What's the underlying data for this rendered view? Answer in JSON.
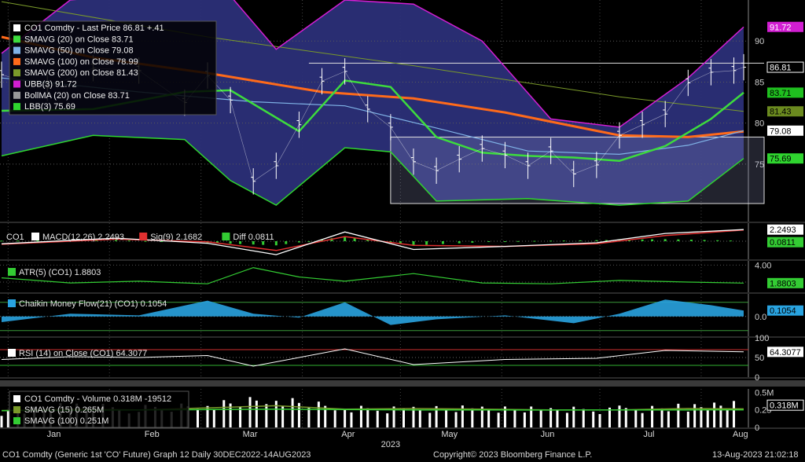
{
  "chart_data": {
    "type": "line",
    "x_range": [
      "2022-12-30",
      "2023-08-14"
    ],
    "x_ticks": [
      "Jan",
      "Feb",
      "Mar",
      "Apr",
      "May",
      "Jun",
      "Jul",
      "Aug"
    ],
    "year_label": "2023",
    "footer": {
      "left": "CO1 Comdty (Generic 1st 'CO' Future) Graph 12  Daily 30DEC2022-14AUG2023",
      "center": "Copyright© 2023 Bloomberg Finance L.P.",
      "right": "13-Aug-2023 21:02:18"
    },
    "colors": {
      "price": "#ffffff",
      "sma20": "#3ddc3d",
      "sma50": "#7fb2e6",
      "sma100": "#ff6a1a",
      "sma200": "#7a9a2a",
      "ubb": "#d21ed2",
      "lbb": "#2fd52f",
      "band_fill": "#2b2f78",
      "macd": "#ffffff",
      "signal": "#e03030",
      "diff": "#33cc33",
      "atr": "#33cc33",
      "cmf": "#29a3e0",
      "rsi": "#ffffff",
      "volume": "#ffffff"
    },
    "panels": [
      {
        "id": "price",
        "y_ticks": [
          75,
          80,
          85,
          90
        ],
        "ylim": [
          68,
          95
        ],
        "legend": [
          {
            "swatch": "#ffffff",
            "text": "CO1 Comdty - Last Price 86.81  +.41"
          },
          {
            "swatch": "#3ddc3d",
            "text": "SMAVG (20)  on Close      83.71"
          },
          {
            "swatch": "#7fb2e6",
            "text": "SMAVG (50)  on Close      79.08"
          },
          {
            "swatch": "#ff6a1a",
            "text": "SMAVG (100)  on Close     78.99"
          },
          {
            "swatch": "#7a9a2a",
            "text": "SMAVG (200)  on Close     81.43"
          },
          {
            "swatch": "#d21ed2",
            "text": "UBB(3)                     91.72"
          },
          {
            "swatch": "#9a9a9a",
            "text": "BollMA (20)  on Close     83.71"
          },
          {
            "swatch": "#2fd52f",
            "text": "LBB(3)                     75.69"
          }
        ],
        "badges": [
          {
            "text": "91.72",
            "value": 91.72,
            "bg": "#d21ed2",
            "fg": "#ffffff"
          },
          {
            "text": "86.81",
            "value": 86.81,
            "bg": "#000000",
            "fg": "#ffffff",
            "border": "#ffffff"
          },
          {
            "text": "83.71",
            "value": 83.71,
            "bg": "#1fbf1f",
            "fg": "#000000"
          },
          {
            "text": "81.43",
            "value": 81.43,
            "bg": "#6b8a1f",
            "fg": "#000000"
          },
          {
            "text": "79.08",
            "value": 79.08,
            "bg": "#ffffff",
            "fg": "#000000"
          },
          {
            "text": "75.69",
            "value": 75.69,
            "bg": "#2fd52f",
            "fg": "#000000"
          }
        ],
        "price_x": [
          "2022-12-30",
          "2023-01-13",
          "2023-01-27",
          "2023-02-10",
          "2023-02-24",
          "2023-03-03",
          "2023-03-10",
          "2023-03-17",
          "2023-03-24",
          "2023-03-31",
          "2023-04-07",
          "2023-04-14",
          "2023-04-21",
          "2023-04-28",
          "2023-05-05",
          "2023-05-12",
          "2023-05-19",
          "2023-05-26",
          "2023-06-02",
          "2023-06-09",
          "2023-06-16",
          "2023-06-23",
          "2023-06-30",
          "2023-07-07",
          "2023-07-14",
          "2023-07-21",
          "2023-07-28",
          "2023-08-04",
          "2023-08-11",
          "2023-08-14"
        ],
        "price": [
          85.9,
          84.3,
          86.7,
          86.4,
          82.5,
          85.8,
          82.8,
          72.9,
          74.8,
          79.8,
          85.1,
          86.3,
          81.7,
          79.5,
          75.3,
          74.2,
          75.6,
          76.9,
          76.1,
          74.8,
          76.6,
          73.8,
          74.9,
          78.5,
          79.8,
          81.1,
          84.9,
          86.2,
          86.4,
          86.81
        ],
        "sma20_x": [
          "2022-12-30",
          "2023-01-27",
          "2023-02-24",
          "2023-03-10",
          "2023-03-31",
          "2023-04-14",
          "2023-04-28",
          "2023-05-12",
          "2023-05-26",
          "2023-06-09",
          "2023-06-23",
          "2023-07-07",
          "2023-07-21",
          "2023-08-04",
          "2023-08-14"
        ],
        "sma20": [
          81.5,
          81.7,
          83.8,
          84.0,
          79.0,
          85.2,
          84.4,
          78.3,
          76.4,
          76.0,
          75.8,
          75.4,
          77.2,
          80.5,
          83.71
        ],
        "sma50_x": [
          "2022-12-30",
          "2023-02-10",
          "2023-03-17",
          "2023-04-14",
          "2023-05-12",
          "2023-06-09",
          "2023-07-07",
          "2023-07-28",
          "2023-08-14"
        ],
        "sma50": [
          85.5,
          83.8,
          82.6,
          82.1,
          79.4,
          76.6,
          76.2,
          77.3,
          79.08
        ],
        "sma100_x": [
          "2022-12-30",
          "2023-01-27",
          "2023-03-03",
          "2023-04-07",
          "2023-05-05",
          "2023-06-02",
          "2023-07-07",
          "2023-07-28",
          "2023-08-14"
        ],
        "sma100": [
          90.5,
          88.0,
          86.1,
          83.8,
          83.0,
          81.3,
          78.5,
          78.3,
          78.99
        ],
        "sma200_x": [
          "2022-12-30",
          "2023-03-03",
          "2023-05-05",
          "2023-07-07",
          "2023-08-14"
        ],
        "sma200": [
          94.8,
          90.5,
          87.0,
          83.2,
          81.43
        ],
        "ubb_x": [
          "2022-12-30",
          "2023-01-20",
          "2023-02-17",
          "2023-03-10",
          "2023-03-24",
          "2023-04-14",
          "2023-05-05",
          "2023-05-26",
          "2023-06-16",
          "2023-07-07",
          "2023-07-28",
          "2023-08-14"
        ],
        "ubb": [
          88.5,
          95.0,
          96.0,
          95.5,
          89.0,
          95.0,
          94.5,
          90.0,
          80.5,
          79.5,
          85.5,
          91.72
        ],
        "lbb_x": [
          "2022-12-30",
          "2023-01-27",
          "2023-02-24",
          "2023-03-10",
          "2023-03-24",
          "2023-04-14",
          "2023-04-28",
          "2023-05-12",
          "2023-06-09",
          "2023-07-07",
          "2023-07-28",
          "2023-08-14"
        ],
        "lbb": [
          76.0,
          78.5,
          78.0,
          73.0,
          70.0,
          77.0,
          76.5,
          70.5,
          70.8,
          70.0,
          70.5,
          75.69
        ],
        "annotations": [
          {
            "type": "resistance",
            "value": 87.3,
            "from": "2023-04-03",
            "to": "2023-08-14"
          },
          {
            "type": "range_box",
            "top": 78.3,
            "bottom": 70.2,
            "from": "2023-04-28",
            "to": "2023-08-14"
          }
        ]
      },
      {
        "id": "macd",
        "legend_title": "CO1",
        "legend": [
          {
            "swatch": "#ffffff",
            "text": "MACD(12,26) 2.2493"
          },
          {
            "swatch": "#e03030",
            "text": "Sig(9) 2.1682"
          },
          {
            "swatch": "#33cc33",
            "text": "Diff 0.0811"
          }
        ],
        "badges": [
          {
            "text": "2.2493",
            "bg": "#ffffff",
            "fg": "#000000"
          },
          {
            "text": "0.0811",
            "bg": "#33cc33",
            "fg": "#000000"
          }
        ],
        "ylim": [
          -3.5,
          3.5
        ],
        "x": [
          "2022-12-30",
          "2023-02-03",
          "2023-03-03",
          "2023-03-24",
          "2023-04-14",
          "2023-05-05",
          "2023-06-02",
          "2023-06-30",
          "2023-07-21",
          "2023-08-14"
        ],
        "macd": [
          -0.5,
          0.6,
          -0.4,
          -2.6,
          1.8,
          -1.6,
          -1.0,
          -0.3,
          1.5,
          2.2493
        ],
        "signal": [
          -0.6,
          0.4,
          -0.1,
          -1.8,
          0.9,
          -0.8,
          -1.0,
          -0.5,
          1.1,
          2.1682
        ]
      },
      {
        "id": "atr",
        "legend": [
          {
            "swatch": "#33cc33",
            "text": "ATR(5)  (CO1) 1.8803"
          }
        ],
        "y_ticks": [
          2,
          4
        ],
        "tick_label": "4.00",
        "badges": [
          {
            "text": "1.8803",
            "bg": "#33cc33",
            "fg": "#000000"
          }
        ],
        "ylim": [
          0.8,
          4.5
        ],
        "x": [
          "2022-12-30",
          "2023-01-20",
          "2023-02-10",
          "2023-03-03",
          "2023-03-17",
          "2023-03-31",
          "2023-04-14",
          "2023-05-05",
          "2023-05-26",
          "2023-06-16",
          "2023-07-07",
          "2023-07-28",
          "2023-08-14"
        ],
        "values": [
          2.5,
          1.9,
          2.1,
          1.8,
          3.7,
          2.6,
          2.1,
          3.0,
          1.9,
          1.8,
          2.2,
          2.0,
          1.8803
        ]
      },
      {
        "id": "cmf",
        "legend": [
          {
            "swatch": "#29a3e0",
            "text": "Chaikin Money Flow(21) (CO1) 0.1054"
          }
        ],
        "badges": [
          {
            "text": "0.1054",
            "bg": "#29a3e0",
            "fg": "#000000"
          }
        ],
        "tick_label": "0.0",
        "ylim": [
          -0.35,
          0.4
        ],
        "x": [
          "2022-12-30",
          "2023-01-20",
          "2023-02-10",
          "2023-03-03",
          "2023-03-17",
          "2023-03-31",
          "2023-04-14",
          "2023-04-28",
          "2023-05-12",
          "2023-06-02",
          "2023-06-23",
          "2023-07-07",
          "2023-07-21",
          "2023-08-04",
          "2023-08-14"
        ],
        "values": [
          -0.1,
          0.05,
          0.02,
          0.28,
          0.05,
          -0.02,
          0.25,
          -0.15,
          -0.05,
          0.02,
          -0.12,
          0.05,
          0.3,
          0.2,
          0.1054
        ]
      },
      {
        "id": "rsi",
        "legend": [
          {
            "swatch": "#ffffff",
            "text": "RSI (14)   on Close (CO1) 64.3077"
          }
        ],
        "y_ticks": [
          0,
          50,
          100
        ],
        "badges": [
          {
            "text": "64.3077",
            "bg": "#ffffff",
            "fg": "#000000"
          }
        ],
        "ylim": [
          0,
          100
        ],
        "x": [
          "2022-12-30",
          "2023-01-20",
          "2023-02-10",
          "2023-03-03",
          "2023-03-17",
          "2023-04-14",
          "2023-05-05",
          "2023-06-02",
          "2023-06-30",
          "2023-07-21",
          "2023-08-14"
        ],
        "values": [
          45,
          52,
          50,
          55,
          28,
          72,
          32,
          45,
          48,
          68,
          64.3077
        ]
      },
      {
        "id": "volume",
        "legend": [
          {
            "swatch": "#ffffff",
            "text": "CO1 Comdty - Volume 0.318M   -19512"
          },
          {
            "swatch": "#7a9a2a",
            "text": "SMAVG (15)              0.265M"
          },
          {
            "swatch": "#33cc33",
            "text": "SMAVG (100)             0.251M"
          }
        ],
        "y_ticks": [
          0,
          0.25,
          0.5
        ],
        "tick_labels": [
          "0.5M",
          "0.25",
          "0"
        ],
        "badges": [
          {
            "text": "0.318M",
            "bg": "#000000",
            "fg": "#ffffff",
            "border": "#ffffff"
          }
        ],
        "ylim": [
          0,
          0.55
        ],
        "x": [
          "2022-12-30",
          "2023-01-20",
          "2023-02-10",
          "2023-03-03",
          "2023-03-24",
          "2023-04-14",
          "2023-05-05",
          "2023-05-26",
          "2023-06-16",
          "2023-07-07",
          "2023-07-28",
          "2023-08-14"
        ],
        "values": [
          0.22,
          0.3,
          0.26,
          0.34,
          0.4,
          0.25,
          0.28,
          0.27,
          0.24,
          0.26,
          0.3,
          0.318
        ],
        "sma15": [
          0.24,
          0.26,
          0.25,
          0.28,
          0.31,
          0.26,
          0.27,
          0.26,
          0.25,
          0.25,
          0.27,
          0.265
        ],
        "sma100": [
          0.24,
          0.245,
          0.25,
          0.255,
          0.26,
          0.255,
          0.25,
          0.25,
          0.248,
          0.25,
          0.25,
          0.251
        ]
      }
    ]
  }
}
